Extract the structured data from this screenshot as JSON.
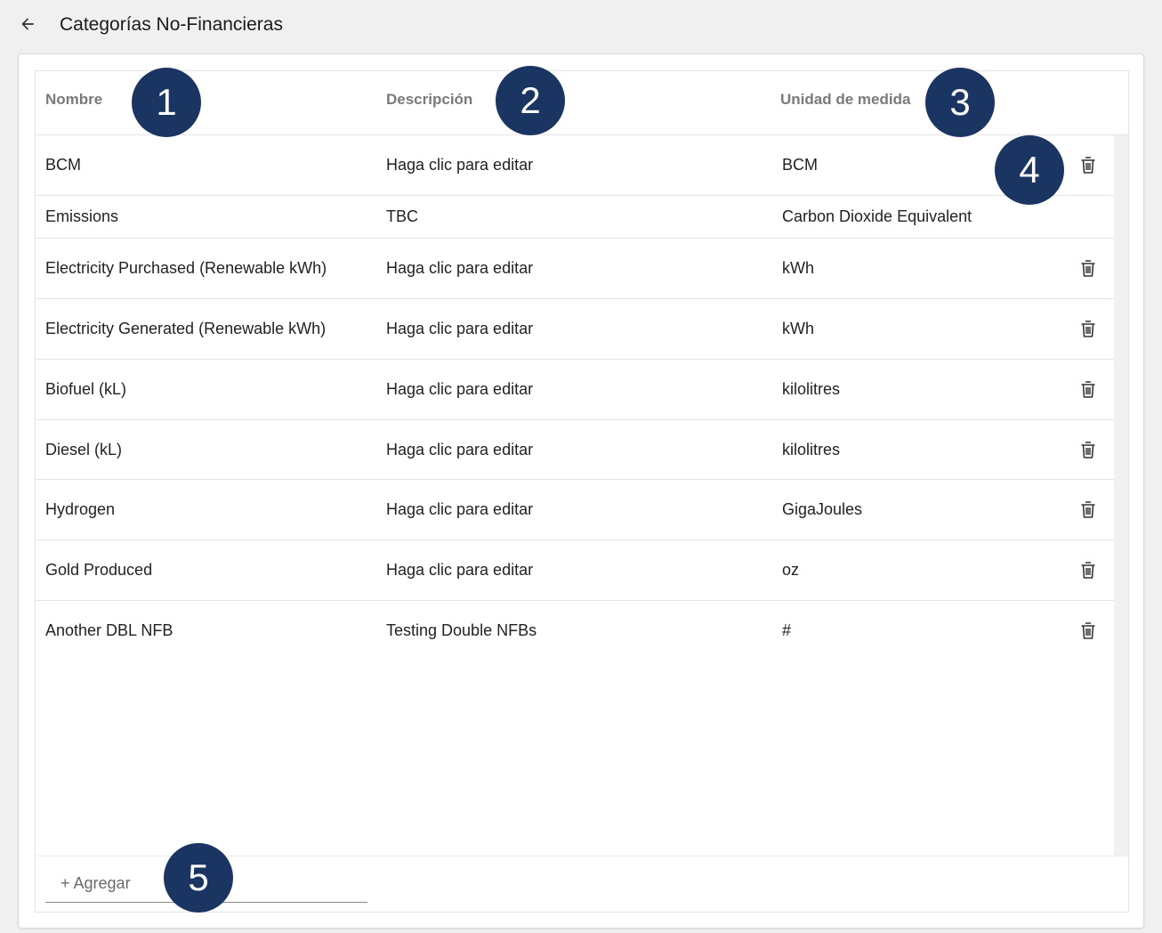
{
  "header": {
    "title": "Categorías No-Financieras",
    "back_icon": "arrow-left-icon"
  },
  "table": {
    "columns": {
      "name": "Nombre",
      "description": "Descripción",
      "unit": "Unidad de medida"
    },
    "rows": [
      {
        "name": "BCM",
        "description": "Haga clic para editar",
        "unit": "BCM",
        "deletable": true
      },
      {
        "name": "Emissions",
        "description": "TBC",
        "unit": "Carbon Dioxide Equivalent",
        "deletable": false
      },
      {
        "name": "Electricity Purchased (Renewable kWh)",
        "description": "Haga clic para editar",
        "unit": "kWh",
        "deletable": true
      },
      {
        "name": "Electricity Generated (Renewable kWh)",
        "description": "Haga clic para editar",
        "unit": "kWh",
        "deletable": true
      },
      {
        "name": "Biofuel (kL)",
        "description": "Haga clic para editar",
        "unit": "kilolitres",
        "deletable": true
      },
      {
        "name": "Diesel (kL)",
        "description": "Haga clic para editar",
        "unit": "kilolitres",
        "deletable": true
      },
      {
        "name": "Hydrogen",
        "description": "Haga clic para editar",
        "unit": "GigaJoules",
        "deletable": true
      },
      {
        "name": "Gold Produced",
        "description": "Haga clic para editar",
        "unit": "oz",
        "deletable": true
      },
      {
        "name": "Another DBL NFB",
        "description": "Testing Double NFBs",
        "unit": "#",
        "deletable": true
      }
    ],
    "delete_icon": "trash-icon"
  },
  "footer": {
    "add_label": "+ Agregar"
  },
  "annotations": {
    "badge_1": "1",
    "badge_2": "2",
    "badge_3": "3",
    "badge_4": "4",
    "badge_5": "5",
    "badge_color": "#1b3563"
  }
}
